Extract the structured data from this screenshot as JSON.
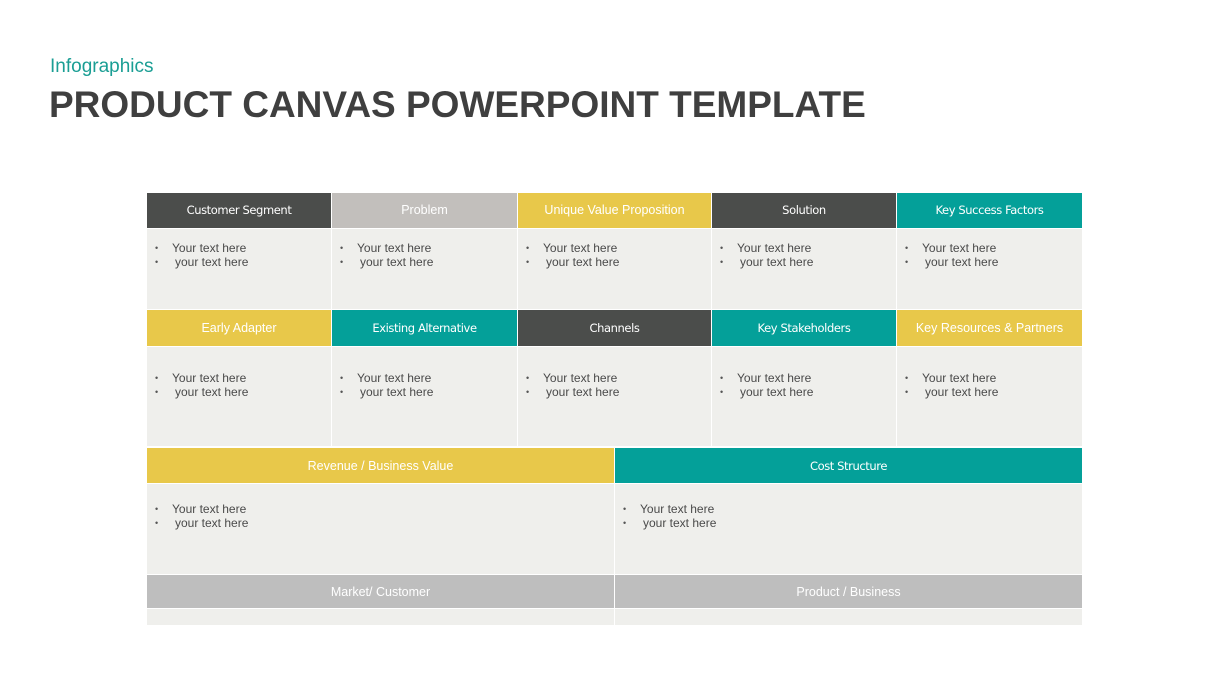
{
  "slide": {
    "subtitle": "Infographics",
    "title": "PRODUCT CANVAS POWERPOINT TEMPLATE"
  },
  "colors": {
    "dark": "#4b4d4b",
    "gray": "#c2bfbc",
    "yellow": "#e8c84a",
    "teal": "#04a099",
    "silver": "#bebebe",
    "cell_bg": "#efefec",
    "subtitle": "#1a9e94",
    "title": "#3f3f3f"
  },
  "bullet_symbol": "•",
  "rows": [
    {
      "cells": [
        {
          "title": "Customer Segment",
          "color": "dark",
          "bullets": [
            "Your text here",
            "your text here"
          ]
        },
        {
          "title": "Problem",
          "color": "gray",
          "bullets": [
            "Your text here",
            "your text here"
          ]
        },
        {
          "title": "Unique Value Proposition",
          "color": "yellow",
          "bullets": [
            "Your text here",
            "your text here"
          ]
        },
        {
          "title": "Solution",
          "color": "dark",
          "bullets": [
            "Your text here",
            "your text here"
          ]
        },
        {
          "title": "Key Success Factors",
          "color": "teal",
          "bullets": [
            "Your text here",
            "your text here"
          ]
        }
      ]
    },
    {
      "cells": [
        {
          "title": "Early Adapter",
          "color": "yellow",
          "bullets": [
            "Your text here",
            "your text here"
          ]
        },
        {
          "title": "Existing Alternative",
          "color": "teal",
          "bullets": [
            "Your text here",
            "your text here"
          ]
        },
        {
          "title": "Channels",
          "color": "dark",
          "bullets": [
            "Your text here",
            "your text here"
          ]
        },
        {
          "title": "Key Stakeholders",
          "color": "teal",
          "bullets": [
            "Your text here",
            "your text here"
          ]
        },
        {
          "title": "Key Resources & Partners",
          "color": "yellow",
          "bullets": [
            "Your text here",
            "your text here"
          ]
        }
      ]
    },
    {
      "cells": [
        {
          "title": "Revenue / Business Value",
          "color": "yellow",
          "bullets": [
            "Your text here",
            "your text here"
          ]
        },
        {
          "title": "Cost Structure",
          "color": "teal",
          "bullets": [
            "Your text here",
            "your text here"
          ]
        }
      ]
    },
    {
      "cells": [
        {
          "title": "Market/ Customer",
          "color": "silver",
          "bullets": []
        },
        {
          "title": "Product / Business",
          "color": "silver",
          "bullets": []
        }
      ]
    }
  ]
}
